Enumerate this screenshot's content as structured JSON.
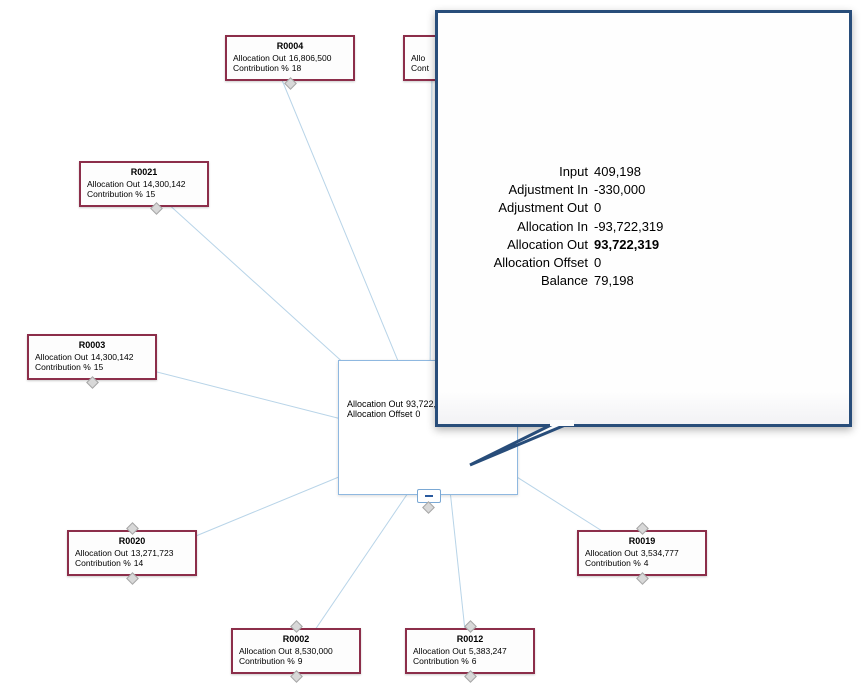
{
  "labels": {
    "allocation_out": "Allocation Out",
    "contribution_pct": "Contribution %",
    "allocation_offset": "Allocation Offset"
  },
  "center": {
    "allocation_out": "93,722,",
    "allocation_offset": "0"
  },
  "nodes": {
    "r0004": {
      "title": "R0004",
      "allocation_out": "16,806,500",
      "contribution_pct": "18"
    },
    "r0021": {
      "title": "R0021",
      "allocation_out": "14,300,142",
      "contribution_pct": "15"
    },
    "r0003": {
      "title": "R0003",
      "allocation_out": "14,300,142",
      "contribution_pct": "15"
    },
    "r0020": {
      "title": "R0020",
      "allocation_out": "13,271,723",
      "contribution_pct": "14"
    },
    "r0002": {
      "title": "R0002",
      "allocation_out": "8,530,000",
      "contribution_pct": "9"
    },
    "r0012": {
      "title": "R0012",
      "allocation_out": "5,383,247",
      "contribution_pct": "6"
    },
    "r0019": {
      "title": "R0019",
      "allocation_out": "3,534,777",
      "contribution_pct": "4"
    },
    "partial1": {
      "allocation_out_prefix": "Allo",
      "contribution_prefix": "Cont"
    }
  },
  "tooltip": {
    "rows": {
      "input": {
        "label": "Input",
        "value": "409,198"
      },
      "adj_in": {
        "label": "Adjustment In",
        "value": "-330,000"
      },
      "adj_out": {
        "label": "Adjustment Out",
        "value": "0"
      },
      "alloc_in": {
        "label": "Allocation In",
        "value": "-93,722,319"
      },
      "alloc_out": {
        "label": "Allocation Out",
        "value": "93,722,319"
      },
      "alloc_offset": {
        "label": "Allocation Offset",
        "value": "0"
      },
      "balance": {
        "label": "Balance",
        "value": "79,198"
      }
    }
  }
}
